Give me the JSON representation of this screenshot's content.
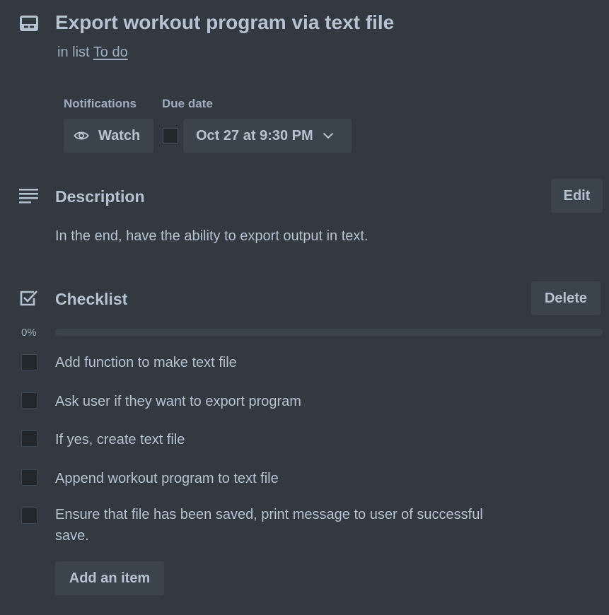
{
  "card": {
    "title": "Export workout program via text file",
    "in_list_prefix": "in list",
    "list_name": "To do",
    "icon": "card-icon"
  },
  "notifications": {
    "label": "Notifications",
    "watch_label": "Watch",
    "icon": "eye-icon"
  },
  "due_date": {
    "label": "Due date",
    "value": "Oct 27 at 9:30 PM",
    "checked": false
  },
  "description": {
    "title": "Description",
    "edit_label": "Edit",
    "text": "In the end, have the ability to export output in text.",
    "icon": "description-lines-icon"
  },
  "checklist": {
    "title": "Checklist",
    "delete_label": "Delete",
    "progress_label": "0%",
    "progress": 0,
    "icon": "checklist-icon",
    "items": [
      {
        "text": "Add function to make text file",
        "checked": false
      },
      {
        "text": "Ask user if they want to export program",
        "checked": false
      },
      {
        "text": "If yes, create text file",
        "checked": false
      },
      {
        "text": "Append workout program to text file",
        "checked": false
      },
      {
        "text": "Ensure that file has been saved, print message to user of successful save.",
        "checked": false
      }
    ],
    "add_item_label": "Add an item"
  },
  "colors": {
    "background": "#323941",
    "button": "#3b444c",
    "text": "#b6c2cf",
    "muted_text": "#9fadbc"
  }
}
